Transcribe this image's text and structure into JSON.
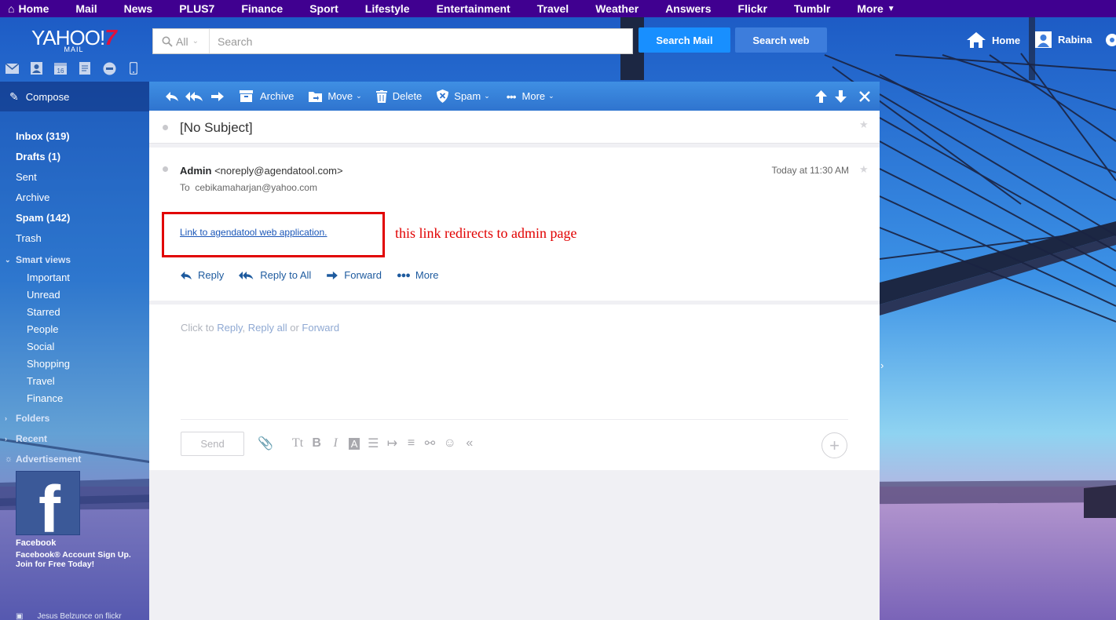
{
  "topnav": {
    "items": [
      "Home",
      "Mail",
      "News",
      "PLUS7",
      "Finance",
      "Sport",
      "Lifestyle",
      "Entertainment",
      "Travel",
      "Weather",
      "Answers",
      "Flickr",
      "Tumblr",
      "More"
    ]
  },
  "header": {
    "logo_text": "YAHOO!",
    "logo_seven": "7",
    "logo_sub": "MAIL",
    "search_scope": "All",
    "search_placeholder": "Search",
    "search_mail_label": "Search Mail",
    "search_web_label": "Search web",
    "home_label": "Home",
    "user_name": "Rabina"
  },
  "app_icons": [
    "mail-icon",
    "contacts-icon",
    "calendar-icon",
    "notepad-icon",
    "messenger-icon",
    "mobile-icon"
  ],
  "sidebar": {
    "compose_label": "Compose",
    "folders": [
      {
        "label": "Inbox (319)",
        "bold": true
      },
      {
        "label": "Drafts (1)",
        "bold": true
      },
      {
        "label": "Sent",
        "bold": false
      },
      {
        "label": "Archive",
        "bold": false
      },
      {
        "label": "Spam (142)",
        "bold": true
      },
      {
        "label": "Trash",
        "bold": false
      }
    ],
    "smart_views_label": "Smart views",
    "smart_views": [
      "Important",
      "Unread",
      "Starred",
      "People",
      "Social",
      "Shopping",
      "Travel",
      "Finance"
    ],
    "folders_label": "Folders",
    "recent_label": "Recent",
    "advertisement_label": "Advertisement",
    "ad": {
      "title": "Facebook",
      "description": "Facebook® Account Sign Up. Join for Free Today!"
    },
    "photo_credit": "Jesus Belzunce on flickr"
  },
  "toolbar": {
    "archive_label": "Archive",
    "move_label": "Move",
    "delete_label": "Delete",
    "spam_label": "Spam",
    "more_label": "More"
  },
  "message": {
    "subject": "[No Subject]",
    "sender_name": "Admin",
    "sender_email": "<noreply@agendatool.com>",
    "date": "Today at 11:30 AM",
    "to_label": "To",
    "to_address": "cebikamaharjan@yahoo.com",
    "link_text": "Link to agendatool web application.",
    "annotation": "this link redirects to admin page",
    "actions": {
      "reply": "Reply",
      "reply_all": "Reply to All",
      "forward": "Forward",
      "more": "More"
    }
  },
  "reply_box": {
    "hint_prefix": "Click to ",
    "hint_reply": "Reply",
    "hint_sep1": ", ",
    "hint_reply_all": "Reply all",
    "hint_or": " or ",
    "hint_forward": "Forward",
    "send_label": "Send",
    "fmt_text_size": "Tt",
    "fmt_bold": "B",
    "fmt_italic": "I",
    "fmt_color": "A"
  },
  "colors": {
    "topnav_bg": "#400090",
    "search_mail_btn": "#188fff",
    "search_web_btn": "#3d7ddc",
    "toolbar_bg": "#3f8fe3",
    "annotation_red": "#e10000",
    "link_blue": "#1a56b8"
  }
}
